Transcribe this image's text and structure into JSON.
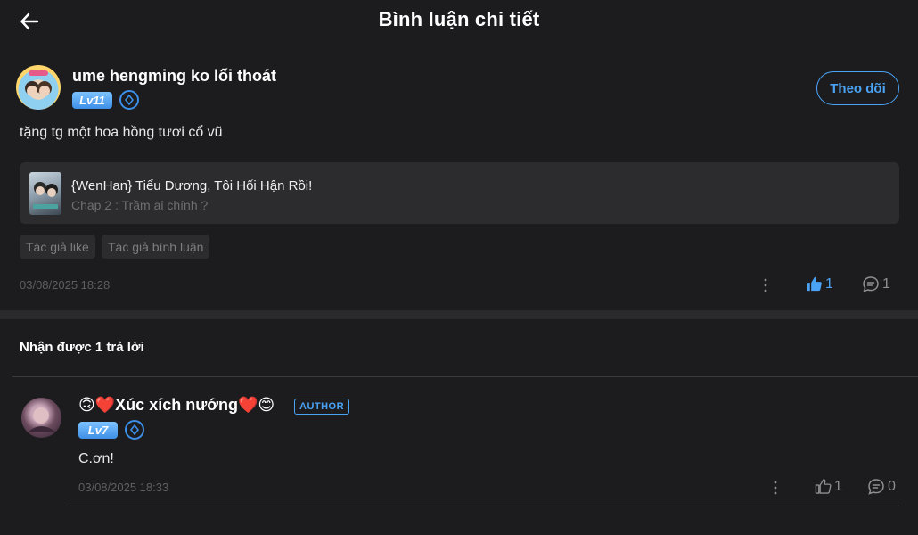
{
  "header": {
    "title": "Bình luận chi tiết",
    "back_icon": "arrow-left-icon"
  },
  "comment": {
    "username": "ume hengming ko lối thoát",
    "level": "Lv11",
    "follow_label": "Theo dõi",
    "text": "tặng tg một hoa hồng tươi cổ vũ",
    "story": {
      "title": "{WenHan} Tiểu Dương, Tôi Hối Hận Rồi!",
      "chapter": "Chap 2 : Trầm ai chính ?"
    },
    "tags": [
      "Tác giả like",
      "Tác giả bình luận"
    ],
    "timestamp": "03/08/2025 18:28",
    "like_count": "1",
    "reply_count": "1"
  },
  "replies_header": "Nhận được 1 trả lời",
  "reply": {
    "username": "🙃❤️Xúc xích nướng❤️😊",
    "author_tag": "AUTHOR",
    "level": "Lv7",
    "text": "C.ơn!",
    "timestamp": "03/08/2025 18:33",
    "like_count": "1",
    "reply_count": "0"
  },
  "colors": {
    "background": "#1c1c1e",
    "accent": "#4aa3f5",
    "card": "#2c2c2e",
    "muted": "#6e6e73"
  }
}
